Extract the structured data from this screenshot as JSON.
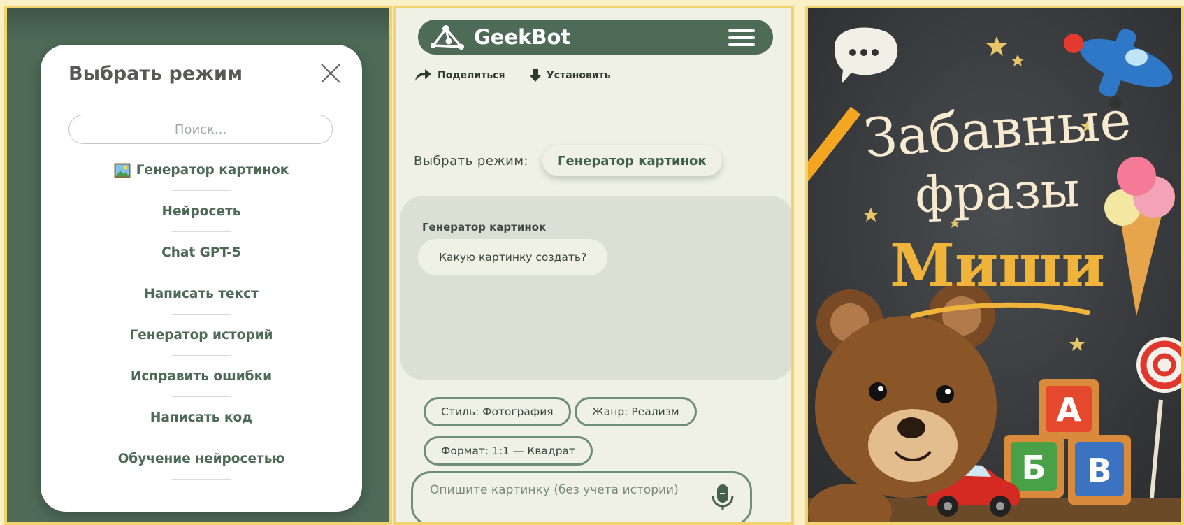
{
  "left": {
    "title": "Выбрать режим",
    "search_placeholder": "Поиск...",
    "items": [
      {
        "label": "Генератор картинок",
        "icon": "picture-icon"
      },
      {
        "label": "Нейросеть"
      },
      {
        "label": "Chat GPT-5"
      },
      {
        "label": "Написать текст"
      },
      {
        "label": "Генератор историй"
      },
      {
        "label": "Исправить ошибки"
      },
      {
        "label": "Написать код"
      },
      {
        "label": "Обучение нейросетью"
      }
    ]
  },
  "mid": {
    "brand": "GeekBot",
    "share_label": "Поделиться",
    "install_label": "Установить",
    "mode_label": "Выбрать режим:",
    "mode_value": "Генератор картинок",
    "chat": {
      "bot_name": "Генератор картинок",
      "message": "Какую картинку создать?"
    },
    "options": [
      "Стиль: Фотография",
      "Жанр: Реализм",
      "Формат: 1:1 — Квадрат"
    ],
    "input_placeholder": "Опишите картинку (без учета истории)"
  },
  "right": {
    "line1": "Забавные",
    "line2": "фразы",
    "line3": "Миши",
    "blocks": [
      "А",
      "Б",
      "В"
    ]
  },
  "colors": {
    "accent_green": "#4e6b57",
    "panel_border": "#f2d36d",
    "chalkboard": "#3b3e40",
    "title_orange": "#f0b43a"
  }
}
